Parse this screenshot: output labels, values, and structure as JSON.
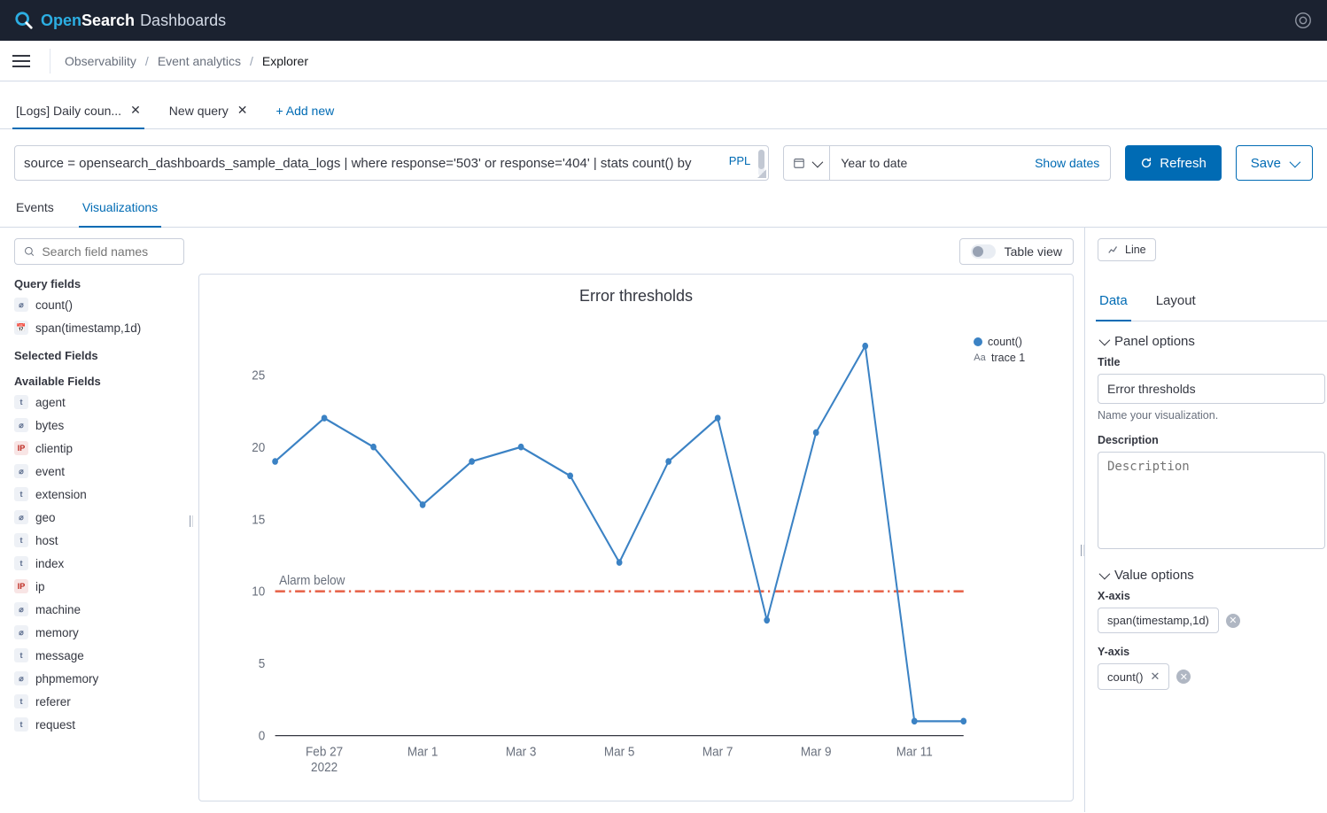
{
  "brand": {
    "open": "Open",
    "search": "Search",
    "dash": "Dashboards"
  },
  "breadcrumb": {
    "a": "Observability",
    "b": "Event analytics",
    "c": "Explorer"
  },
  "queryTabs": {
    "t1": "[Logs] Daily coun...",
    "t2": "New query",
    "add": "+ Add new"
  },
  "query": {
    "text": "source = opensearch_dashboards_sample_data_logs | where response='503' or response='404' | stats count() by span(timestamp,1d)",
    "ppl": "PPL"
  },
  "time": {
    "range": "Year to date",
    "showdates": "Show dates",
    "refresh": "Refresh",
    "save": "Save"
  },
  "subtabs": {
    "events": "Events",
    "viz": "Visualizations"
  },
  "left": {
    "searchPlaceholder": "Search field names",
    "queryFields": "Query fields",
    "qf": {
      "count": "count()",
      "span": "span(timestamp,1d)"
    },
    "selected": "Selected Fields",
    "available": "Available Fields",
    "fields": {
      "agent": "agent",
      "bytes": "bytes",
      "clientip": "clientip",
      "event": "event",
      "extension": "extension",
      "geo": "geo",
      "host": "host",
      "index": "index",
      "ip": "ip",
      "machine": "machine",
      "memory": "memory",
      "message": "message",
      "phpmemory": "phpmemory",
      "referer": "referer",
      "request": "request"
    }
  },
  "center": {
    "tableview": "Table view",
    "chartTitle": "Error thresholds",
    "legend": {
      "series": "count()",
      "trace": "trace 1",
      "aa": "Aa"
    },
    "thresholdLabel": "Alarm below"
  },
  "right": {
    "viztype": "Line",
    "tabs": {
      "data": "Data",
      "layout": "Layout"
    },
    "panelOptions": "Panel options",
    "titleLabel": "Title",
    "titleValue": "Error thresholds",
    "titleHelp": "Name your visualization.",
    "descLabel": "Description",
    "descPlaceholder": "Description",
    "valueOptions": "Value options",
    "xaxisLabel": "X-axis",
    "xaxisValue": "span(timestamp,1d)",
    "yaxisLabel": "Y-axis",
    "yaxisValue": "count()"
  },
  "chart_data": {
    "type": "line",
    "title": "Error thresholds",
    "series": [
      {
        "name": "count()",
        "x": [
          "Feb 26 2022",
          "Feb 27 2022",
          "Feb 28 2022",
          "Mar 1 2022",
          "Mar 2 2022",
          "Mar 3 2022",
          "Mar 4 2022",
          "Mar 5 2022",
          "Mar 6 2022",
          "Mar 7 2022",
          "Mar 8 2022",
          "Mar 9 2022",
          "Mar 10 2022",
          "Mar 11 2022",
          "Mar 12 2022"
        ],
        "y": [
          19,
          22,
          20,
          16,
          19,
          20,
          18,
          12,
          19,
          22,
          8,
          21,
          27,
          1,
          1
        ]
      }
    ],
    "x_tick_labels": [
      "Feb 27\n2022",
      "Mar 1",
      "Mar 3",
      "Mar 5",
      "Mar 7",
      "Mar 9",
      "Mar 11"
    ],
    "y_ticks": [
      0,
      5,
      10,
      15,
      20,
      25
    ],
    "ylim": [
      0,
      28
    ],
    "threshold": {
      "label": "Alarm below",
      "value": 10,
      "style": "dash-dot",
      "color": "#e7664c"
    },
    "legend": [
      "count()",
      "trace 1"
    ],
    "xlabel": "",
    "ylabel": ""
  }
}
